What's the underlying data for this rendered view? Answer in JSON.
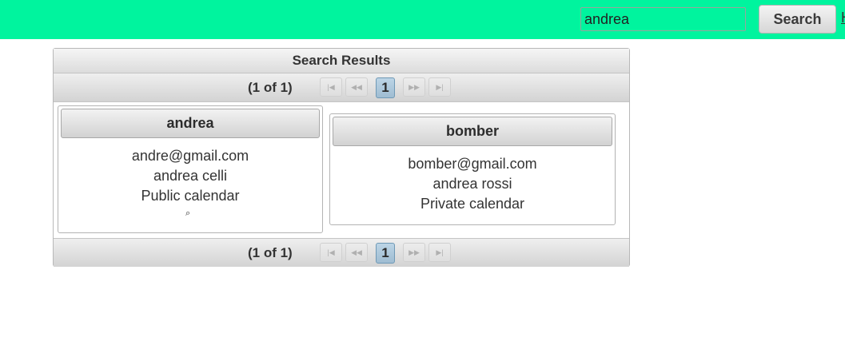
{
  "topbar": {
    "search_value": "andrea",
    "search_button_label": "Search",
    "link_label": "H"
  },
  "results": {
    "title": "Search Results",
    "paginator_top": {
      "report": "(1 of 1)",
      "first": "|◀",
      "prev": "◀◀",
      "page": "1",
      "next": "▶▶",
      "last": "▶|"
    },
    "paginator_bottom": {
      "report": "(1 of 1)",
      "first": "|◀",
      "prev": "◀◀",
      "page": "1",
      "next": "▶▶",
      "last": "▶|"
    },
    "cards": [
      {
        "username": "andrea",
        "email": "andre@gmail.com",
        "full_name": "andrea celli",
        "calendar": "Public calendar",
        "icon": "magnifier-icon"
      },
      {
        "username": "bomber",
        "email": "bomber@gmail.com",
        "full_name": "andrea rossi",
        "calendar": "Private calendar"
      }
    ]
  },
  "colors": {
    "topbar": "#00f49e",
    "page_highlight": "#a9c6da"
  }
}
